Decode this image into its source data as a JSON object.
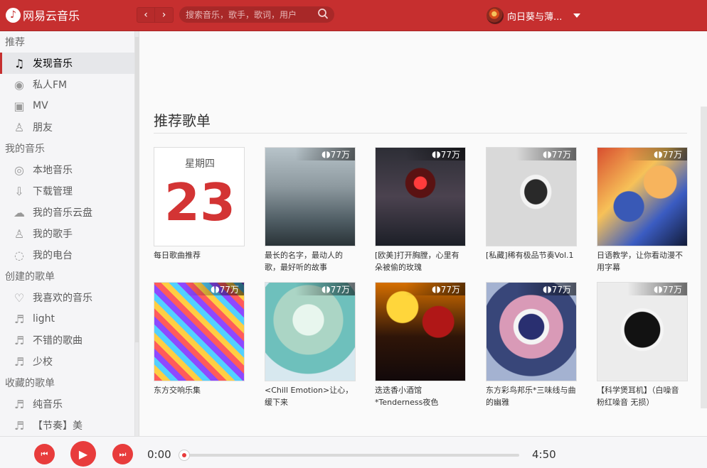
{
  "app": {
    "logo_text": "网易云音乐",
    "search_placeholder": "搜索音乐，歌手，歌词，用户",
    "user_name": "向日葵与薄..."
  },
  "sidebar": {
    "sections": [
      {
        "title": "推荐",
        "items": [
          {
            "label": "发现音乐",
            "icon": "music-note-icon",
            "active": true
          },
          {
            "label": "私人FM",
            "icon": "radio-icon"
          },
          {
            "label": "MV",
            "icon": "video-icon"
          },
          {
            "label": "朋友",
            "icon": "friend-icon"
          }
        ]
      },
      {
        "title": "我的音乐",
        "items": [
          {
            "label": "本地音乐",
            "icon": "disc-icon"
          },
          {
            "label": "下载管理",
            "icon": "download-icon"
          },
          {
            "label": "我的音乐云盘",
            "icon": "cloud-icon"
          },
          {
            "label": "我的歌手",
            "icon": "singer-icon"
          },
          {
            "label": "我的电台",
            "icon": "podcast-icon"
          }
        ]
      },
      {
        "title": "创建的歌单",
        "items": [
          {
            "label": "我喜欢的音乐",
            "icon": "heart-icon"
          },
          {
            "label": "light",
            "icon": "playlist-icon"
          },
          {
            "label": "不错的歌曲",
            "icon": "playlist-icon"
          },
          {
            "label": "少校",
            "icon": "playlist-icon"
          }
        ]
      },
      {
        "title": "收藏的歌单",
        "items": [
          {
            "label": "纯音乐",
            "icon": "playlist-icon"
          },
          {
            "label": "【节奏】美",
            "icon": "playlist-icon"
          }
        ]
      }
    ]
  },
  "main": {
    "heading": "推荐歌单",
    "daily": {
      "weekday": "星期四",
      "day": "23",
      "title": "每日歌曲推荐"
    },
    "playlists": [
      {
        "title": "最长的名字，最动人的歌，最好听的故事",
        "plays": "77万"
      },
      {
        "title": "[欧美]打开胸膛，心里有朵被偷的玫瑰",
        "plays": "77万"
      },
      {
        "title": "[私藏]稀有极品节奏Vol.1",
        "plays": "77万"
      },
      {
        "title": "日语教学，让你看动漫不用字幕",
        "plays": "77万"
      },
      {
        "title": "东方交响乐集",
        "plays": "77万"
      },
      {
        "title": "<Chill Emotion>让心，缓下来",
        "plays": "77万"
      },
      {
        "title": "迭迭香小酒馆*Tenderness夜色",
        "plays": "77万"
      },
      {
        "title": "东方彩鸟邦乐*三味线与曲的幽雅",
        "plays": "77万"
      },
      {
        "title": "【科学煲耳机】（白噪音 粉红噪音 无损）",
        "plays": "77万"
      }
    ]
  },
  "player": {
    "current_time": "0:00",
    "total_time": "4:50",
    "progress": 0
  },
  "colors": {
    "brand": "#c62f2f",
    "accent": "#e83c3c"
  }
}
